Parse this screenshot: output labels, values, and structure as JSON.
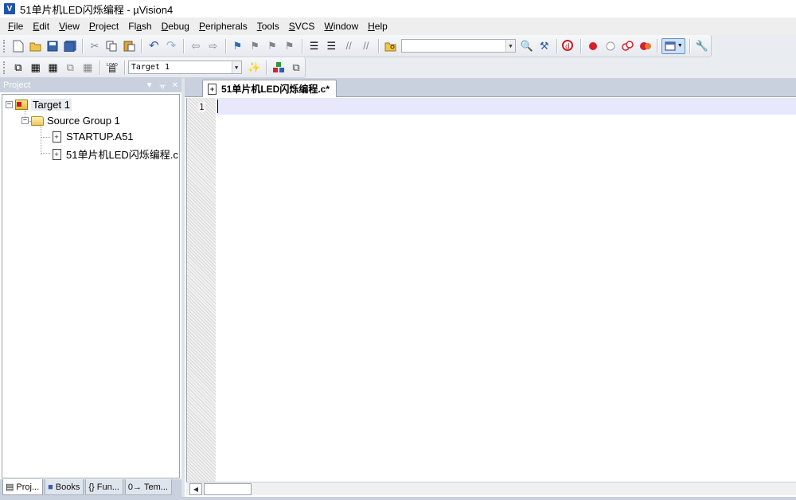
{
  "window": {
    "title": "51单片机LED闪烁编程  - µVision4",
    "app_icon": "V"
  },
  "menu": [
    {
      "label": "File",
      "underline": "F",
      "rest": "ile"
    },
    {
      "label": "Edit",
      "underline": "E",
      "rest": "dit"
    },
    {
      "label": "View",
      "underline": "V",
      "rest": "iew"
    },
    {
      "label": "Project",
      "underline": "P",
      "rest": "roject"
    },
    {
      "label": "Flash",
      "pre": "Fl",
      "underline": "a",
      "rest": "sh"
    },
    {
      "label": "Debug",
      "underline": "D",
      "rest": "ebug"
    },
    {
      "label": "Peripherals",
      "underline": "P",
      "rest": "eripherals"
    },
    {
      "label": "Tools",
      "underline": "T",
      "rest": "ools"
    },
    {
      "label": "SVCS",
      "underline": "S",
      "rest": "VCS"
    },
    {
      "label": "Window",
      "underline": "W",
      "rest": "indow"
    },
    {
      "label": "Help",
      "underline": "H",
      "rest": "elp"
    }
  ],
  "toolbar2": {
    "load_label": "LOAD",
    "target_select": "Target 1"
  },
  "project_panel": {
    "title": "Project",
    "pin_glyph": "▼ ⊓ ✕",
    "tree": {
      "target": "Target 1",
      "group": "Source Group 1",
      "files": [
        "STARTUP.A51",
        "51单片机LED闪烁编程.c"
      ]
    },
    "tabs": [
      {
        "icon": "▤",
        "label": "Proj..."
      },
      {
        "icon": "📘",
        "label": "Books"
      },
      {
        "icon": "{}",
        "label": "Fun..."
      },
      {
        "icon": "0→",
        "label": "Tem..."
      }
    ]
  },
  "editor": {
    "tab_label": "51单片机LED闪烁编程.c*",
    "line_numbers": [
      "1"
    ]
  },
  "colors": {
    "panel_header": "#c8d1dd",
    "current_line": "#e7e8fb",
    "menu_bg": "#eeeeef"
  }
}
